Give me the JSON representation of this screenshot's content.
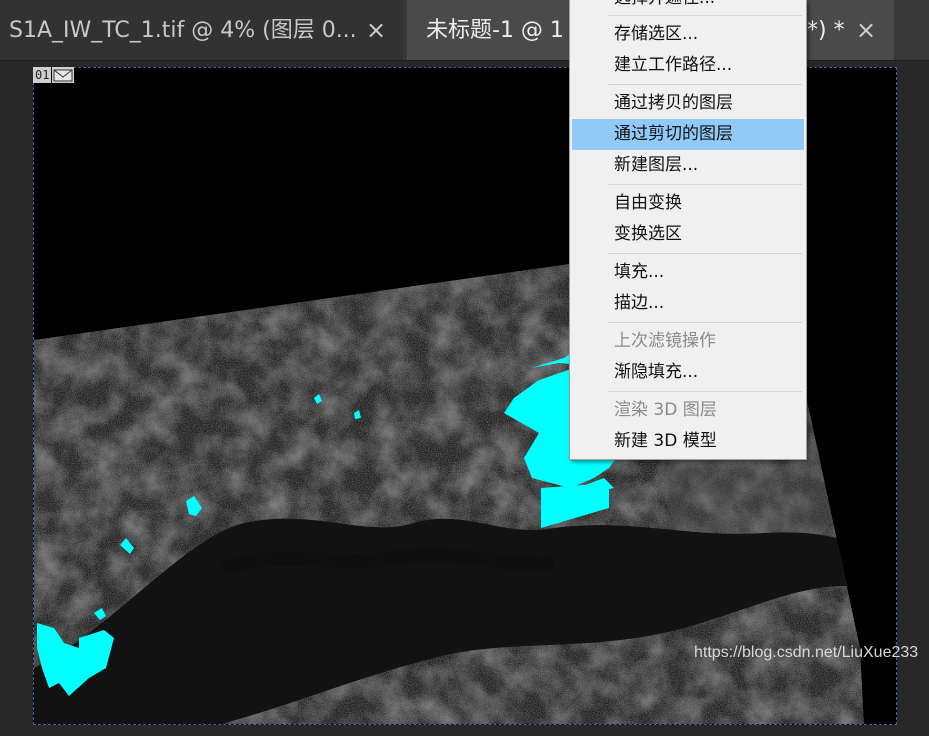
{
  "tabs": [
    {
      "title": "S1A_IW_TC_1.tif @ 4% (图层 0...",
      "close_label": "×"
    },
    {
      "title": "未标题-1 @ 1",
      "title_tail": "*) *",
      "close_label": "×"
    }
  ],
  "document": {
    "layer_number": "01"
  },
  "context_menu": {
    "items": [
      {
        "label": "选择并遮住...",
        "enabled": true,
        "highlighted": false
      },
      {
        "label": "存储选区...",
        "enabled": true,
        "highlighted": false
      },
      {
        "label": "建立工作路径...",
        "enabled": true,
        "highlighted": false
      },
      {
        "label": "通过拷贝的图层",
        "enabled": true,
        "highlighted": false
      },
      {
        "label": "通过剪切的图层",
        "enabled": true,
        "highlighted": true
      },
      {
        "label": "新建图层...",
        "enabled": true,
        "highlighted": false
      },
      {
        "label": "自由变换",
        "enabled": true,
        "highlighted": false
      },
      {
        "label": "变换选区",
        "enabled": true,
        "highlighted": false
      },
      {
        "label": "填充...",
        "enabled": true,
        "highlighted": false
      },
      {
        "label": "描边...",
        "enabled": true,
        "highlighted": false
      },
      {
        "label": "上次滤镜操作",
        "enabled": false,
        "highlighted": false
      },
      {
        "label": "渐隐填充...",
        "enabled": true,
        "highlighted": false
      },
      {
        "label": "渲染 3D 图层",
        "enabled": false,
        "highlighted": false
      },
      {
        "label": "新建 3D 模型",
        "enabled": true,
        "highlighted": false
      }
    ]
  },
  "watermark": "https://blog.csdn.net/LiuXue233",
  "colors": {
    "selection_fill": "#00ffff",
    "menu_highlight": "#91c9f7",
    "workspace_bg": "#282828"
  }
}
